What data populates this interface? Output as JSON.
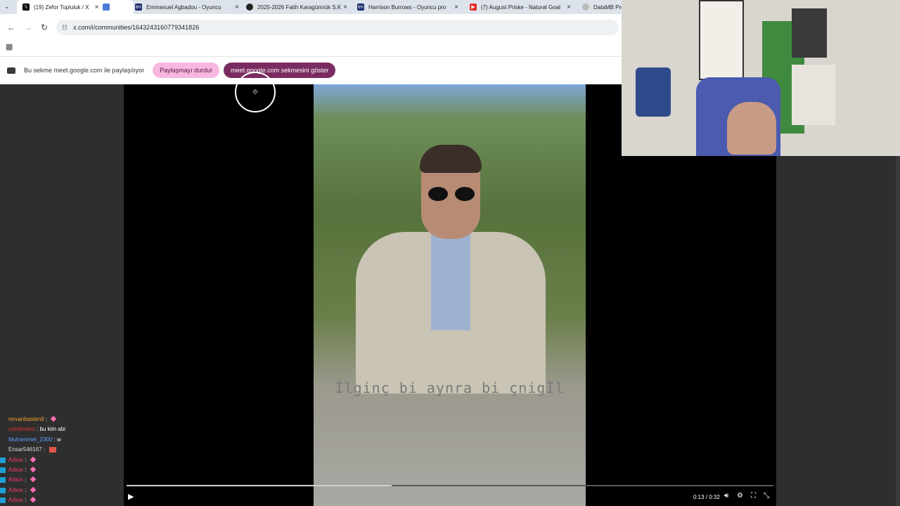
{
  "tabs": [
    {
      "label": "(19) Zefor Topluluk / X",
      "icon": "x-logo-icon",
      "active": true
    },
    {
      "label": "",
      "icon": "meet-tab-icon",
      "active": false
    },
    {
      "label": "Emmanuel Agbadou - Oyuncu",
      "icon": "transfermarkt-icon",
      "active": false
    },
    {
      "label": "2025-2026 Fatih Karagümrük S.K",
      "icon": "site-icon",
      "active": false
    },
    {
      "label": "Harrison Burrows - Oyuncu pro",
      "icon": "transfermarkt-icon",
      "active": false
    },
    {
      "label": "(7) August Priske - Natural Goal",
      "icon": "youtube-icon",
      "active": false
    },
    {
      "label": "DataMB Pro",
      "icon": "datamb-icon",
      "active": false
    }
  ],
  "address": {
    "url": "x.com/i/communities/1643243160779341826"
  },
  "share_bar": {
    "info": "Bu sekme meet.google.com ile paylaşılıyor",
    "stop_label": "Paylaşmayı durdur",
    "show_label": "meet.google.com sekmesini göster"
  },
  "video": {
    "caption": "İlginç bi aynra bi çnigİl",
    "time": "0:13 / 0:32",
    "progress": 0.41
  },
  "chat": [
    {
      "user": "mrvanbasten9",
      "message": "",
      "user_color": "#f0a030",
      "emote": "heart",
      "badge": false
    },
    {
      "user": "cardenano",
      "message": "bu kim abi",
      "user_color": "#e03030",
      "emote": "",
      "badge": false
    },
    {
      "user": "Muhammet_2300",
      "message": "w",
      "user_color": "#5aa0ff",
      "emote": "",
      "badge": false
    },
    {
      "user": "Ensar546167",
      "message": "",
      "user_color": "#dddddd",
      "emote": "face",
      "badge": false
    },
    {
      "user": "Arbox",
      "message": "",
      "user_color": "#ff3a6a",
      "emote": "heart",
      "badge": true
    },
    {
      "user": "Arbox",
      "message": "",
      "user_color": "#ff3a6a",
      "emote": "heart",
      "badge": true
    },
    {
      "user": "Arbox",
      "message": "",
      "user_color": "#ff3a6a",
      "emote": "heart",
      "badge": true
    },
    {
      "user": "Arbox",
      "message": "",
      "user_color": "#ff3a6a",
      "emote": "heart",
      "badge": true
    },
    {
      "user": "Arbox",
      "message": "",
      "user_color": "#ff3a6a",
      "emote": "heart",
      "badge": true
    }
  ],
  "colors": {
    "accent_stop": "#f6b8e0",
    "accent_show": "#7a2c60"
  }
}
